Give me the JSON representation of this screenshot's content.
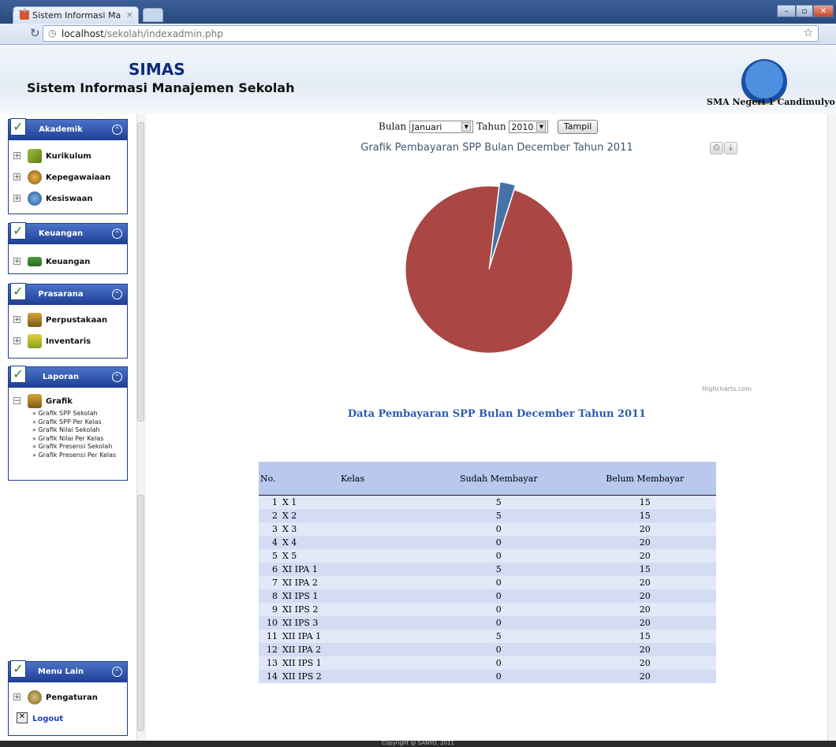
{
  "browser": {
    "tab_title": "Sistem Informasi Manajeme",
    "tab_close": "×",
    "url_host": "localhost",
    "url_path": "/sekolah/indexadmin.php",
    "window_buttons": [
      "–",
      "▫",
      "✕"
    ]
  },
  "header": {
    "app_name": "SIMAS",
    "app_subtitle": "Sistem Informasi Manajemen Sekolah",
    "school_name": "SMA Negeri 1 Candimulyo"
  },
  "sidebar": {
    "akademik": {
      "title": "Akademik",
      "items": [
        "Kurikulum",
        "Kepegawaiaan",
        "Kesiswaan"
      ]
    },
    "keuangan": {
      "title": "Keuangan",
      "items": [
        "Keuangan"
      ]
    },
    "prasarana": {
      "title": "Prasarana",
      "items": [
        "Perpustakaan",
        "Inventaris"
      ]
    },
    "laporan": {
      "title": "Laporan",
      "items": [
        "Grafik"
      ],
      "subitems": [
        "» Grafik SPP Sekolah",
        "» Grafik SPP Per Kelas",
        "» Grafik Nilai Sekolah",
        "» Grafik Nilai Per Kelas",
        "» Grafik Presensi Sekolah",
        "» Grafik Presensi Per Kelas"
      ]
    },
    "menu_lain": {
      "title": "Menu Lain",
      "items": [
        "Pengaturan",
        "Logout"
      ]
    }
  },
  "filter": {
    "bulan_label": "Bulan",
    "bulan_value": "Januari",
    "tahun_label": "Tahun",
    "tahun_value": "2010",
    "submit_label": "Tampil"
  },
  "chart_title": "Grafik Pembayaran SPP Bulan December Tahun 2011",
  "chart_credit": "Highcharts.com",
  "chart_data": {
    "type": "pie",
    "title": "Grafik Pembayaran SPP Bulan December Tahun 2011",
    "slices": [
      {
        "name": "",
        "value": 3,
        "color": "#4572a7"
      },
      {
        "name": "",
        "value": 97,
        "color": "#aa4643"
      }
    ]
  },
  "table": {
    "title": "Data Pembayaran SPP Bulan December Tahun 2011",
    "headers": [
      "No.",
      "Kelas",
      "Sudah Membayar",
      "Belum Membayar"
    ],
    "rows": [
      [
        "1",
        "X 1",
        "5",
        "15"
      ],
      [
        "2",
        "X 2",
        "5",
        "15"
      ],
      [
        "3",
        "X 3",
        "0",
        "20"
      ],
      [
        "4",
        "X 4",
        "0",
        "20"
      ],
      [
        "5",
        "X 5",
        "0",
        "20"
      ],
      [
        "6",
        "XI IPA 1",
        "5",
        "15"
      ],
      [
        "7",
        "XI IPA 2",
        "0",
        "20"
      ],
      [
        "8",
        "XI IPS 1",
        "0",
        "20"
      ],
      [
        "9",
        "XI IPS 2",
        "0",
        "20"
      ],
      [
        "10",
        "XI IPS 3",
        "0",
        "20"
      ],
      [
        "11",
        "XII IPA 1",
        "5",
        "15"
      ],
      [
        "12",
        "XII IPA 2",
        "0",
        "20"
      ],
      [
        "13",
        "XII IPS 1",
        "0",
        "20"
      ],
      [
        "14",
        "XII IPS 2",
        "0",
        "20"
      ]
    ]
  },
  "footer_text": "Copyright @ SANYO, 2011"
}
